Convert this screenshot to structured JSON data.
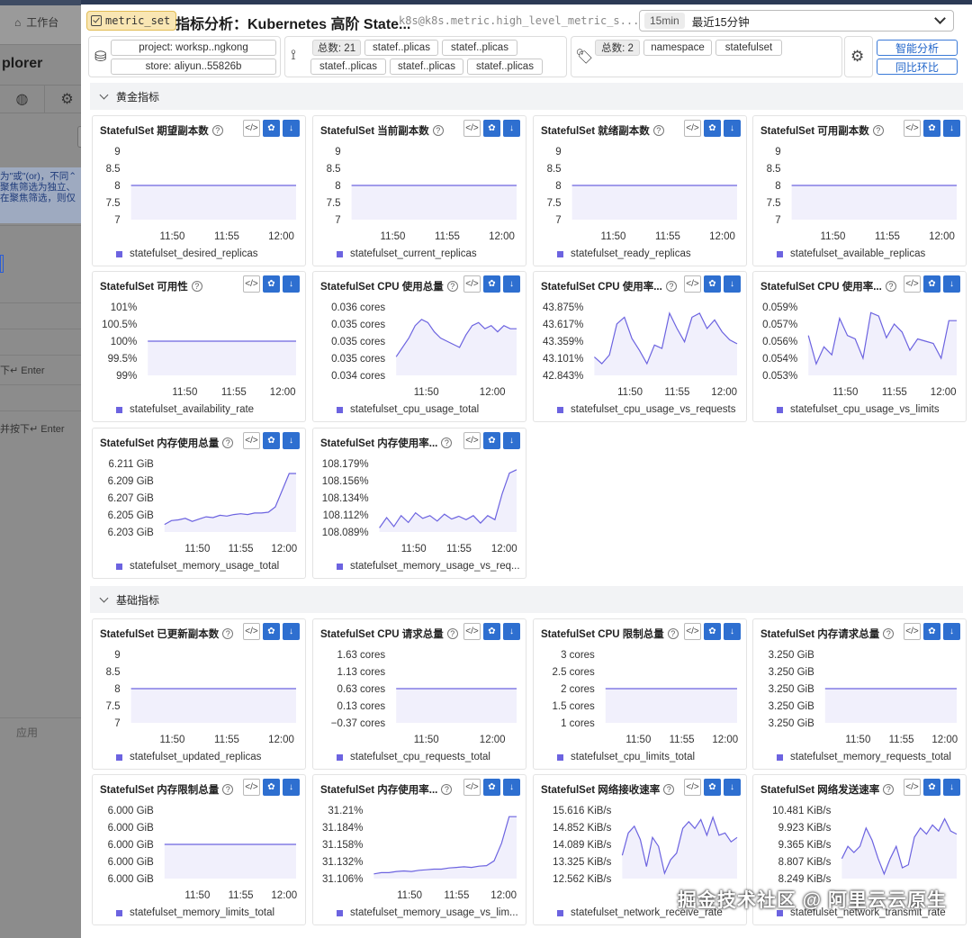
{
  "background": {
    "nav_label": "工作台",
    "explorer_title": "plorer",
    "hint_lines": [
      "为\"或\"(or)，不同⌃",
      "聚焦筛选为独立、",
      "在聚焦筛选，则仅"
    ],
    "enter_hint_1": "下↵ Enter",
    "enter_hint_2": "并按下↵ Enter",
    "apply_label": "应用"
  },
  "header": {
    "tag": "metric_set",
    "title": "指标分析：Kubernetes 高阶 State...",
    "metric_id": "k8s@k8s.metric.high_level_metric_s...",
    "time_badge": "15min",
    "time_label": "最近15分钟"
  },
  "filters": {
    "scope_chips": [
      "project: worksp..ngkong",
      "store: aliyun..55826b"
    ],
    "entity_count": "总数: 21",
    "entity_chips": [
      "statef..plicas",
      "statef..plicas",
      "statef..plicas",
      "statef..plicas",
      "statef..plicas"
    ],
    "label_count": "总数: 2",
    "label_chips": [
      "namespace",
      "statefulset"
    ],
    "smart_analysis": "智能分析",
    "compare": "同比环比"
  },
  "sections": {
    "golden": "黄金指标",
    "basic": "基础指标"
  },
  "watermark": "掘金技术社区 @ 阿里云云原生",
  "colors": {
    "series": "#6c63e0",
    "fill": "#ebeafb",
    "button_blue": "#2e6fd0"
  },
  "cards": [
    {
      "title": "StatefulSet 期望副本数",
      "legend": "statefulset_desired_replicas",
      "yticks": [
        "9",
        "8.5",
        "8",
        "7.5",
        "7"
      ],
      "xticks": [
        "11:50",
        "11:55",
        "12:00"
      ],
      "values": [
        8,
        8,
        8,
        8,
        8,
        8,
        8,
        8,
        8,
        8,
        8,
        8,
        8,
        8,
        8,
        8,
        8,
        8,
        8,
        8
      ],
      "ymin": 7,
      "ymax": 9
    },
    {
      "title": "StatefulSet 当前副本数",
      "legend": "statefulset_current_replicas",
      "yticks": [
        "9",
        "8.5",
        "8",
        "7.5",
        "7"
      ],
      "xticks": [
        "11:50",
        "11:55",
        "12:00"
      ],
      "values": [
        8,
        8,
        8,
        8,
        8,
        8,
        8,
        8,
        8,
        8,
        8,
        8,
        8,
        8,
        8,
        8,
        8,
        8,
        8,
        8
      ],
      "ymin": 7,
      "ymax": 9
    },
    {
      "title": "StatefulSet 就绪副本数",
      "legend": "statefulset_ready_replicas",
      "yticks": [
        "9",
        "8.5",
        "8",
        "7.5",
        "7"
      ],
      "xticks": [
        "11:50",
        "11:55",
        "12:00"
      ],
      "values": [
        8,
        8,
        8,
        8,
        8,
        8,
        8,
        8,
        8,
        8,
        8,
        8,
        8,
        8,
        8,
        8,
        8,
        8,
        8,
        8
      ],
      "ymin": 7,
      "ymax": 9
    },
    {
      "title": "StatefulSet 可用副本数",
      "legend": "statefulset_available_replicas",
      "yticks": [
        "9",
        "8.5",
        "8",
        "7.5",
        "7"
      ],
      "xticks": [
        "11:50",
        "11:55",
        "12:00"
      ],
      "values": [
        8,
        8,
        8,
        8,
        8,
        8,
        8,
        8,
        8,
        8,
        8,
        8,
        8,
        8,
        8,
        8,
        8,
        8,
        8,
        8
      ],
      "ymin": 7,
      "ymax": 9
    },
    {
      "title": "StatefulSet 可用性",
      "legend": "statefulset_availability_rate",
      "yticks": [
        "101%",
        "100.5%",
        "100%",
        "99.5%",
        "99%"
      ],
      "xticks": [
        "11:50",
        "11:55",
        "12:00"
      ],
      "values": [
        100,
        100,
        100,
        100,
        100,
        100,
        100,
        100,
        100,
        100,
        100,
        100,
        100,
        100,
        100,
        100,
        100,
        100,
        100,
        100
      ],
      "ymin": 99,
      "ymax": 101
    },
    {
      "title": "StatefulSet CPU 使用总量",
      "legend": "statefulset_cpu_usage_total",
      "yticks": [
        "0.036 cores",
        "0.035 cores",
        "0.035 cores",
        "0.035 cores",
        "0.034 cores"
      ],
      "xticks": [
        "11:50",
        "12:00"
      ],
      "values": [
        0.0346,
        0.0349,
        0.0352,
        0.0356,
        0.0358,
        0.0357,
        0.0354,
        0.0352,
        0.0351,
        0.035,
        0.0349,
        0.0353,
        0.0356,
        0.0357,
        0.0355,
        0.0356,
        0.0354,
        0.0356,
        0.0355,
        0.0355
      ],
      "ymin": 0.034,
      "ymax": 0.0362
    },
    {
      "title": "StatefulSet CPU 使用率...",
      "legend": "statefulset_cpu_usage_vs_requests",
      "yticks": [
        "43.875%",
        "43.617%",
        "43.359%",
        "43.101%",
        "42.843%"
      ],
      "xticks": [
        "11:50",
        "11:55",
        "12:00"
      ],
      "values": [
        43.12,
        43.02,
        43.15,
        43.62,
        43.72,
        43.4,
        43.22,
        43.02,
        43.3,
        43.25,
        43.78,
        43.55,
        43.35,
        43.72,
        43.78,
        43.55,
        43.68,
        43.5,
        43.38,
        43.32
      ],
      "ymin": 42.843,
      "ymax": 43.875
    },
    {
      "title": "StatefulSet CPU 使用率...",
      "legend": "statefulset_cpu_usage_vs_limits",
      "yticks": [
        "0.059%",
        "0.057%",
        "0.056%",
        "0.054%",
        "0.053%"
      ],
      "xticks": [
        "11:50",
        "11:55",
        "12:00"
      ],
      "values": [
        0.0565,
        0.054,
        0.0555,
        0.0548,
        0.058,
        0.0565,
        0.0562,
        0.0545,
        0.0585,
        0.0582,
        0.0563,
        0.0575,
        0.0568,
        0.0552,
        0.0562,
        0.056,
        0.0558,
        0.0545,
        0.0578,
        0.0578
      ],
      "ymin": 0.053,
      "ymax": 0.059
    },
    {
      "title": "StatefulSet 内存使用总量",
      "legend": "statefulset_memory_usage_total",
      "yticks": [
        "6.211 GiB",
        "6.209 GiB",
        "6.207 GiB",
        "6.205 GiB",
        "6.203 GiB"
      ],
      "xticks": [
        "11:50",
        "11:55",
        "12:00"
      ],
      "values": [
        6.2035,
        6.204,
        6.2041,
        6.2043,
        6.2039,
        6.2042,
        6.2045,
        6.2044,
        6.2047,
        6.2046,
        6.2048,
        6.2049,
        6.2048,
        6.205,
        6.205,
        6.2051,
        6.2058,
        6.208,
        6.2102,
        6.2102
      ],
      "ymin": 6.2025,
      "ymax": 6.2115
    },
    {
      "title": "StatefulSet 内存使用率...",
      "legend": "statefulset_memory_usage_vs_req...",
      "yticks": [
        "108.179%",
        "108.156%",
        "108.134%",
        "108.112%",
        "108.089%"
      ],
      "xticks": [
        "11:50",
        "11:55",
        "12:00"
      ],
      "values": [
        108.09,
        108.105,
        108.092,
        108.108,
        108.098,
        108.112,
        108.104,
        108.108,
        108.1,
        108.11,
        108.103,
        108.107,
        108.102,
        108.108,
        108.097,
        108.108,
        108.102,
        108.14,
        108.17,
        108.175
      ],
      "ymin": 108.084,
      "ymax": 108.184
    },
    {
      "title": "StatefulSet 已更新副本数",
      "legend": "statefulset_updated_replicas",
      "yticks": [
        "9",
        "8.5",
        "8",
        "7.5",
        "7"
      ],
      "xticks": [
        "11:50",
        "11:55",
        "12:00"
      ],
      "values": [
        8,
        8,
        8,
        8,
        8,
        8,
        8,
        8,
        8,
        8,
        8,
        8,
        8,
        8,
        8,
        8,
        8,
        8,
        8,
        8
      ],
      "ymin": 7,
      "ymax": 9
    },
    {
      "title": "StatefulSet CPU 请求总量",
      "legend": "statefulset_cpu_requests_total",
      "yticks": [
        "1.63 cores",
        "1.13 cores",
        "0.63 cores",
        "0.13 cores",
        "−0.37 cores"
      ],
      "xticks": [
        "11:50",
        "12:00"
      ],
      "values": [
        0.63,
        0.63,
        0.63,
        0.63,
        0.63,
        0.63,
        0.63,
        0.63,
        0.63,
        0.63,
        0.63,
        0.63,
        0.63,
        0.63,
        0.63,
        0.63,
        0.63,
        0.63,
        0.63,
        0.63
      ],
      "ymin": -0.37,
      "ymax": 1.63
    },
    {
      "title": "StatefulSet CPU 限制总量",
      "legend": "statefulset_cpu_limits_total",
      "yticks": [
        "3 cores",
        "2.5 cores",
        "2 cores",
        "1.5 cores",
        "1 cores"
      ],
      "xticks": [
        "11:50",
        "11:55",
        "12:00"
      ],
      "values": [
        2,
        2,
        2,
        2,
        2,
        2,
        2,
        2,
        2,
        2,
        2,
        2,
        2,
        2,
        2,
        2,
        2,
        2,
        2,
        2
      ],
      "ymin": 1,
      "ymax": 3
    },
    {
      "title": "StatefulSet 内存请求总量",
      "legend": "statefulset_memory_requests_total",
      "yticks": [
        "3.250 GiB",
        "3.250 GiB",
        "3.250 GiB",
        "3.250 GiB",
        "3.250 GiB"
      ],
      "xticks": [
        "11:50",
        "11:55",
        "12:00"
      ],
      "values": [
        3.25,
        3.25,
        3.25,
        3.25,
        3.25,
        3.25,
        3.25,
        3.25,
        3.25,
        3.25,
        3.25,
        3.25,
        3.25,
        3.25,
        3.25,
        3.25,
        3.25,
        3.25,
        3.25,
        3.25
      ],
      "ymin": 3.24,
      "ymax": 3.26
    },
    {
      "title": "StatefulSet 内存限制总量",
      "legend": "statefulset_memory_limits_total",
      "yticks": [
        "6.000 GiB",
        "6.000 GiB",
        "6.000 GiB",
        "6.000 GiB",
        "6.000 GiB"
      ],
      "xticks": [
        "11:50",
        "11:55",
        "12:00"
      ],
      "values": [
        6,
        6,
        6,
        6,
        6,
        6,
        6,
        6,
        6,
        6,
        6,
        6,
        6,
        6,
        6,
        6,
        6,
        6,
        6,
        6
      ],
      "ymin": 5.99,
      "ymax": 6.01
    },
    {
      "title": "StatefulSet 内存使用率...",
      "legend": "statefulset_memory_usage_vs_lim...",
      "yticks": [
        "31.21%",
        "31.184%",
        "31.158%",
        "31.132%",
        "31.106%"
      ],
      "xticks": [
        "11:50",
        "11:55",
        "12:00"
      ],
      "values": [
        31.108,
        31.11,
        31.11,
        31.112,
        31.113,
        31.112,
        31.114,
        31.115,
        31.116,
        31.116,
        31.118,
        31.119,
        31.12,
        31.119,
        31.121,
        31.122,
        31.13,
        31.16,
        31.205,
        31.205
      ],
      "ymin": 31.1,
      "ymax": 31.216
    },
    {
      "title": "StatefulSet 网络接收速率",
      "legend": "statefulset_network_receive_rate",
      "yticks": [
        "15.616 KiB/s",
        "14.852 KiB/s",
        "14.089 KiB/s",
        "13.325 KiB/s",
        "12.562 KiB/s"
      ],
      "xticks": [],
      "values": [
        13.6,
        14.6,
        14.9,
        14.3,
        13.1,
        14.4,
        14.0,
        12.8,
        13.4,
        13.7,
        14.8,
        15.1,
        14.8,
        15.2,
        14.5,
        15.3,
        14.5,
        14.6,
        14.2,
        14.4
      ],
      "ymin": 12.562,
      "ymax": 15.616
    },
    {
      "title": "StatefulSet 网络发送速率",
      "legend": "statefulset_network_transmit_rate",
      "yticks": [
        "10.481 KiB/s",
        "9.923 KiB/s",
        "9.365 KiB/s",
        "8.807 KiB/s",
        "8.249 KiB/s"
      ],
      "xticks": [],
      "values": [
        8.9,
        9.3,
        9.1,
        9.3,
        9.9,
        9.5,
        8.9,
        8.4,
        8.9,
        9.3,
        8.6,
        8.7,
        9.6,
        9.9,
        9.7,
        10.0,
        9.8,
        10.2,
        9.8,
        9.7
      ],
      "ymin": 8.249,
      "ymax": 10.481
    }
  ]
}
